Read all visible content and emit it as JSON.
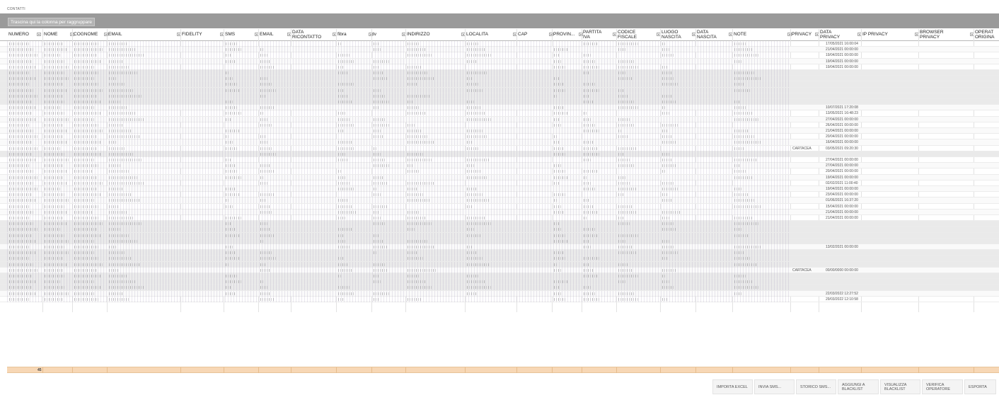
{
  "window": {
    "title": "CONTATTI"
  },
  "group_bar": {
    "hint": "Trascina qui la colonna per raggruppare"
  },
  "columns": [
    {
      "key": "numero",
      "label": "NUMERO"
    },
    {
      "key": "nome",
      "label": "NOME"
    },
    {
      "key": "cognome",
      "label": "COGNOME"
    },
    {
      "key": "email",
      "label": "EMAIL"
    },
    {
      "key": "fidelity",
      "label": "FIDELITY"
    },
    {
      "key": "sms",
      "label": "SMS"
    },
    {
      "key": "email2",
      "label": "EMAIL"
    },
    {
      "key": "data_ricontatto",
      "label": "DATA\nRICONTATTO"
    },
    {
      "key": "fibra",
      "label": "fibra"
    },
    {
      "key": "tv",
      "label": "tv"
    },
    {
      "key": "indirizzo",
      "label": "INDIRIZZO"
    },
    {
      "key": "localita",
      "label": "LOCALITA"
    },
    {
      "key": "cap",
      "label": "CAP"
    },
    {
      "key": "provincia",
      "label": "PROVIN..."
    },
    {
      "key": "partita_iva",
      "label": "PARTITA\nIVA"
    },
    {
      "key": "codice_fiscale",
      "label": "CODICE\nFISCALE"
    },
    {
      "key": "luogo_nascita",
      "label": "LUOGO\nNASCITA"
    },
    {
      "key": "data_nascita",
      "label": "DATA\nNASCITA"
    },
    {
      "key": "note",
      "label": "NOTE"
    },
    {
      "key": "privacy",
      "label": "PRIVACY"
    },
    {
      "key": "data_privacy",
      "label": "DATA\nPRIVACY"
    },
    {
      "key": "ip_privacy",
      "label": "IP PRIVACY"
    },
    {
      "key": "browser_privacy",
      "label": "BROWSER\nPRIVACY"
    },
    {
      "key": "operatore_originale",
      "label": "OPERAT\nORIGINA"
    }
  ],
  "rows": [
    {
      "privacy": "",
      "data_privacy": "17/05/2021 16:00:04"
    },
    {
      "privacy": "",
      "data_privacy": "21/04/2021 00:00:00"
    },
    {
      "privacy": "",
      "data_privacy": "19/04/2021 00:00:00"
    },
    {
      "privacy": "",
      "data_privacy": "19/04/2021 00:00:00"
    },
    {
      "privacy": "",
      "data_privacy": "19/04/2021 00:00:00"
    },
    {
      "privacy": "",
      "data_privacy": ""
    },
    {
      "privacy": "",
      "data_privacy": ""
    },
    {
      "privacy": "",
      "data_privacy": ""
    },
    {
      "privacy": "",
      "data_privacy": ""
    },
    {
      "privacy": "",
      "data_privacy": ""
    },
    {
      "privacy": "",
      "data_privacy": ""
    },
    {
      "privacy": "",
      "data_privacy": "10/07/2021 17:20:08"
    },
    {
      "privacy": "",
      "data_privacy": "13/05/2021 16:48:23"
    },
    {
      "privacy": "",
      "data_privacy": "27/04/2021 00:00:00"
    },
    {
      "privacy": "",
      "data_privacy": "26/04/2021 00:00:00"
    },
    {
      "privacy": "",
      "data_privacy": "21/04/2021 00:00:00"
    },
    {
      "privacy": "",
      "data_privacy": "20/04/2021 00:00:00"
    },
    {
      "privacy": "",
      "data_privacy": "16/04/2021 00:00:00"
    },
    {
      "privacy": "CARTACEA",
      "data_privacy": "03/05/2021 09:20:30"
    },
    {
      "privacy": "",
      "data_privacy": ""
    },
    {
      "privacy": "",
      "data_privacy": "27/04/2021 00:00:00"
    },
    {
      "privacy": "",
      "data_privacy": "27/04/2021 00:00:00"
    },
    {
      "privacy": "",
      "data_privacy": "20/04/2021 00:00:00"
    },
    {
      "privacy": "",
      "data_privacy": "19/04/2021 00:00:00"
    },
    {
      "privacy": "",
      "data_privacy": "02/02/2021 11:00:40"
    },
    {
      "privacy": "",
      "data_privacy": "19/04/2021 00:00:00"
    },
    {
      "privacy": "",
      "data_privacy": "23/04/2021 00:00:00"
    },
    {
      "privacy": "",
      "data_privacy": "01/06/2021 16:37:20"
    },
    {
      "privacy": "",
      "data_privacy": "15/04/2021 00:00:00"
    },
    {
      "privacy": "",
      "data_privacy": "21/04/2021 00:00:00"
    },
    {
      "privacy": "",
      "data_privacy": "21/04/2021 00:00:00"
    },
    {
      "privacy": "",
      "data_privacy": ""
    },
    {
      "privacy": "",
      "data_privacy": ""
    },
    {
      "privacy": "",
      "data_privacy": ""
    },
    {
      "privacy": "",
      "data_privacy": ""
    },
    {
      "privacy": "",
      "data_privacy": "13/02/2021 00:00:00"
    },
    {
      "privacy": "",
      "data_privacy": ""
    },
    {
      "privacy": "",
      "data_privacy": ""
    },
    {
      "privacy": "",
      "data_privacy": ""
    },
    {
      "privacy": "CARTACEA",
      "data_privacy": "00/00/0000 00:00:00"
    },
    {
      "privacy": "",
      "data_privacy": ""
    },
    {
      "privacy": "",
      "data_privacy": ""
    },
    {
      "privacy": "",
      "data_privacy": ""
    },
    {
      "privacy": "",
      "data_privacy": "22/03/2022 12:27:52"
    },
    {
      "privacy": "",
      "data_privacy": "29/03/2022 12:10:58"
    }
  ],
  "footer": {
    "count": "45"
  },
  "actions": [
    {
      "key": "importa_excel",
      "label": "IMPORTA EXCEL"
    },
    {
      "key": "invia_sms",
      "label": "INVIA SMS..."
    },
    {
      "key": "storico_sms",
      "label": "STORICO SMS..."
    },
    {
      "key": "aggiungi_blacklist",
      "label": "AGGIUNGI A\nBLACKLIST"
    },
    {
      "key": "visualizza_blacklist",
      "label": "VISUALIZZA\nBLACKLIST"
    },
    {
      "key": "verifica_operatore",
      "label": "VERIFICA\nOPERATORE"
    },
    {
      "key": "esporta",
      "label": "ESPORTA"
    }
  ]
}
